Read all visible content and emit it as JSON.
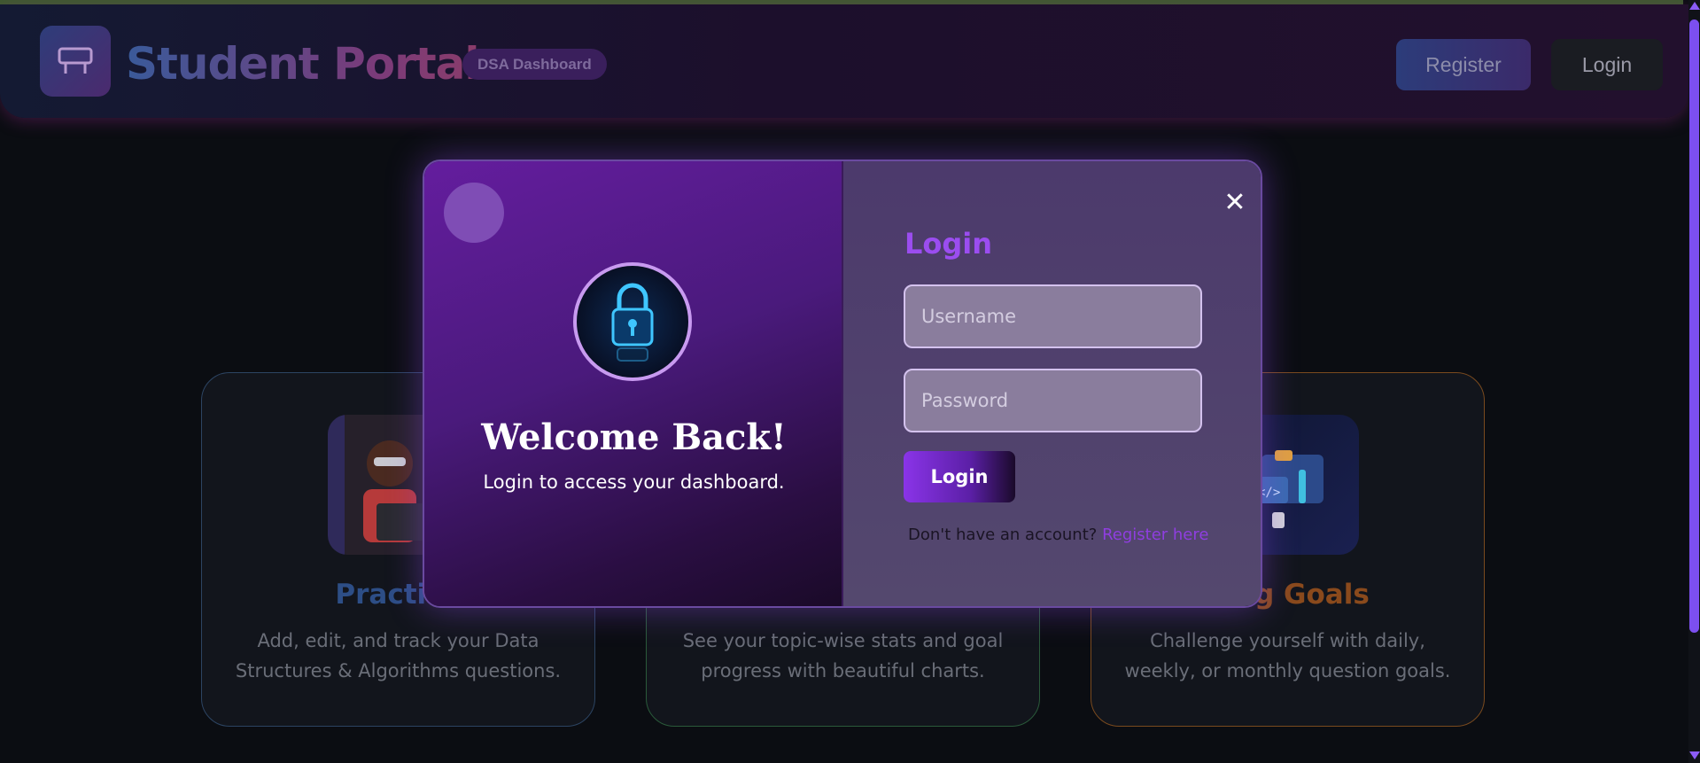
{
  "header": {
    "brand": "Student Portal",
    "badge": "DSA Dashboard",
    "register_label": "Register",
    "login_label": "Login"
  },
  "cards": [
    {
      "title": "Practice",
      "description": "Add, edit, and track your Data Structures & Algorithms questions."
    },
    {
      "title": "",
      "description": "See your topic-wise stats and goal progress with beautiful charts."
    },
    {
      "title": "ding Goals",
      "description": "Challenge yourself with daily, weekly, or monthly question goals."
    }
  ],
  "modal": {
    "welcome_title": "Welcome Back!",
    "welcome_subtitle": "Login to access your dashboard.",
    "close_symbol": "✕",
    "login_heading": "Login",
    "username_placeholder": "Username",
    "password_placeholder": "Password",
    "submit_label": "Login",
    "footer_text": "Don't have an account?",
    "footer_link": "Register here"
  },
  "colors": {
    "accent_purple": "#8b5cf6",
    "link_purple": "#8f3ee0",
    "heading_purple": "#9b4df0"
  },
  "icons": [
    "desk-icon",
    "lock-icon",
    "close-icon",
    "scroll-up-icon",
    "scroll-down-icon"
  ]
}
